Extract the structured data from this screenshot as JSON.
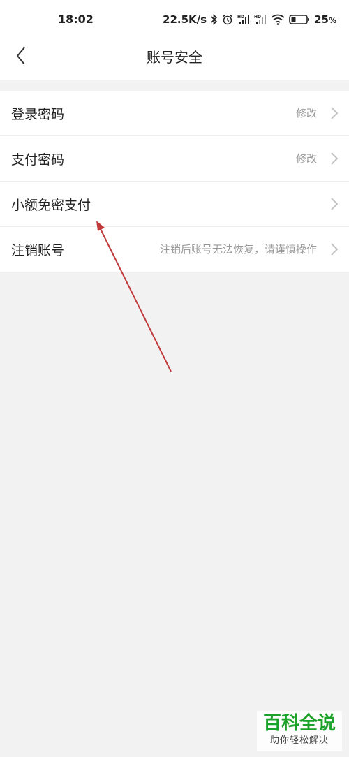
{
  "status_bar": {
    "time": "18:02",
    "net_speed": "22.5K/s",
    "battery": "25",
    "battery_unit": "%"
  },
  "header": {
    "title": "账号安全"
  },
  "menu": [
    {
      "label": "登录密码",
      "value": "修改"
    },
    {
      "label": "支付密码",
      "value": "修改"
    },
    {
      "label": "小额免密支付",
      "value": ""
    },
    {
      "label": "注销账号",
      "value": "注销后账号无法恢复，请谨慎操作"
    }
  ],
  "watermark": {
    "title": "百科全说",
    "subtitle": "助你轻松解决"
  },
  "colors": {
    "annotation_arrow": "#c0393b",
    "watermark_green": "#1ca22a"
  },
  "icons": {
    "back": "chevron-left-icon",
    "row_arrow": "chevron-right-icon"
  }
}
